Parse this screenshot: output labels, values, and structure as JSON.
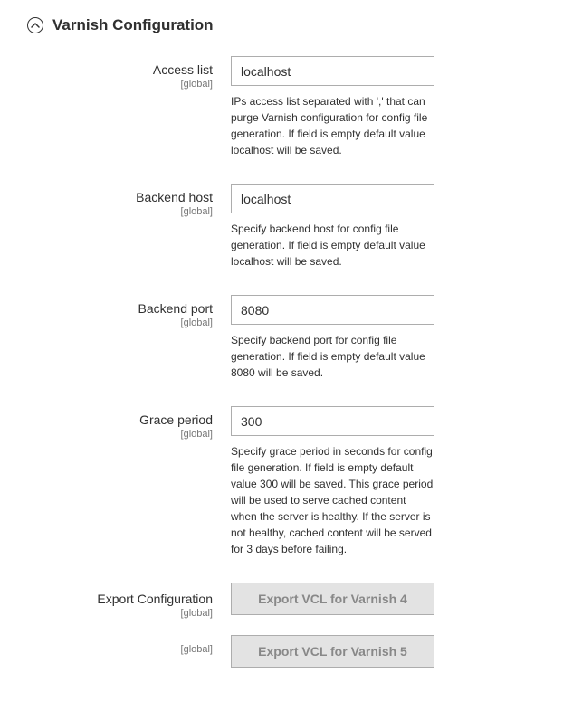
{
  "section": {
    "title": "Varnish Configuration"
  },
  "scope": "[global]",
  "fields": {
    "access_list": {
      "label": "Access list",
      "value": "localhost",
      "help": "IPs access list separated with ',' that can purge Varnish configuration for config file generation. If field is empty default value localhost will be saved."
    },
    "backend_host": {
      "label": "Backend host",
      "value": "localhost",
      "help": "Specify backend host for config file generation. If field is empty default value localhost will be saved."
    },
    "backend_port": {
      "label": "Backend port",
      "value": "8080",
      "help": "Specify backend port for config file generation. If field is empty default value 8080 will be saved."
    },
    "grace_period": {
      "label": "Grace period",
      "value": "300",
      "help": "Specify grace period in seconds for config file generation. If field is empty default value 300 will be saved. This grace period will be used to serve cached content when the server is healthy. If the server is not healthy, cached content will be served for 3 days before failing."
    }
  },
  "export": {
    "label": "Export Configuration",
    "varnish4_label": "Export VCL for Varnish 4",
    "varnish5_label": "Export VCL for Varnish 5"
  }
}
